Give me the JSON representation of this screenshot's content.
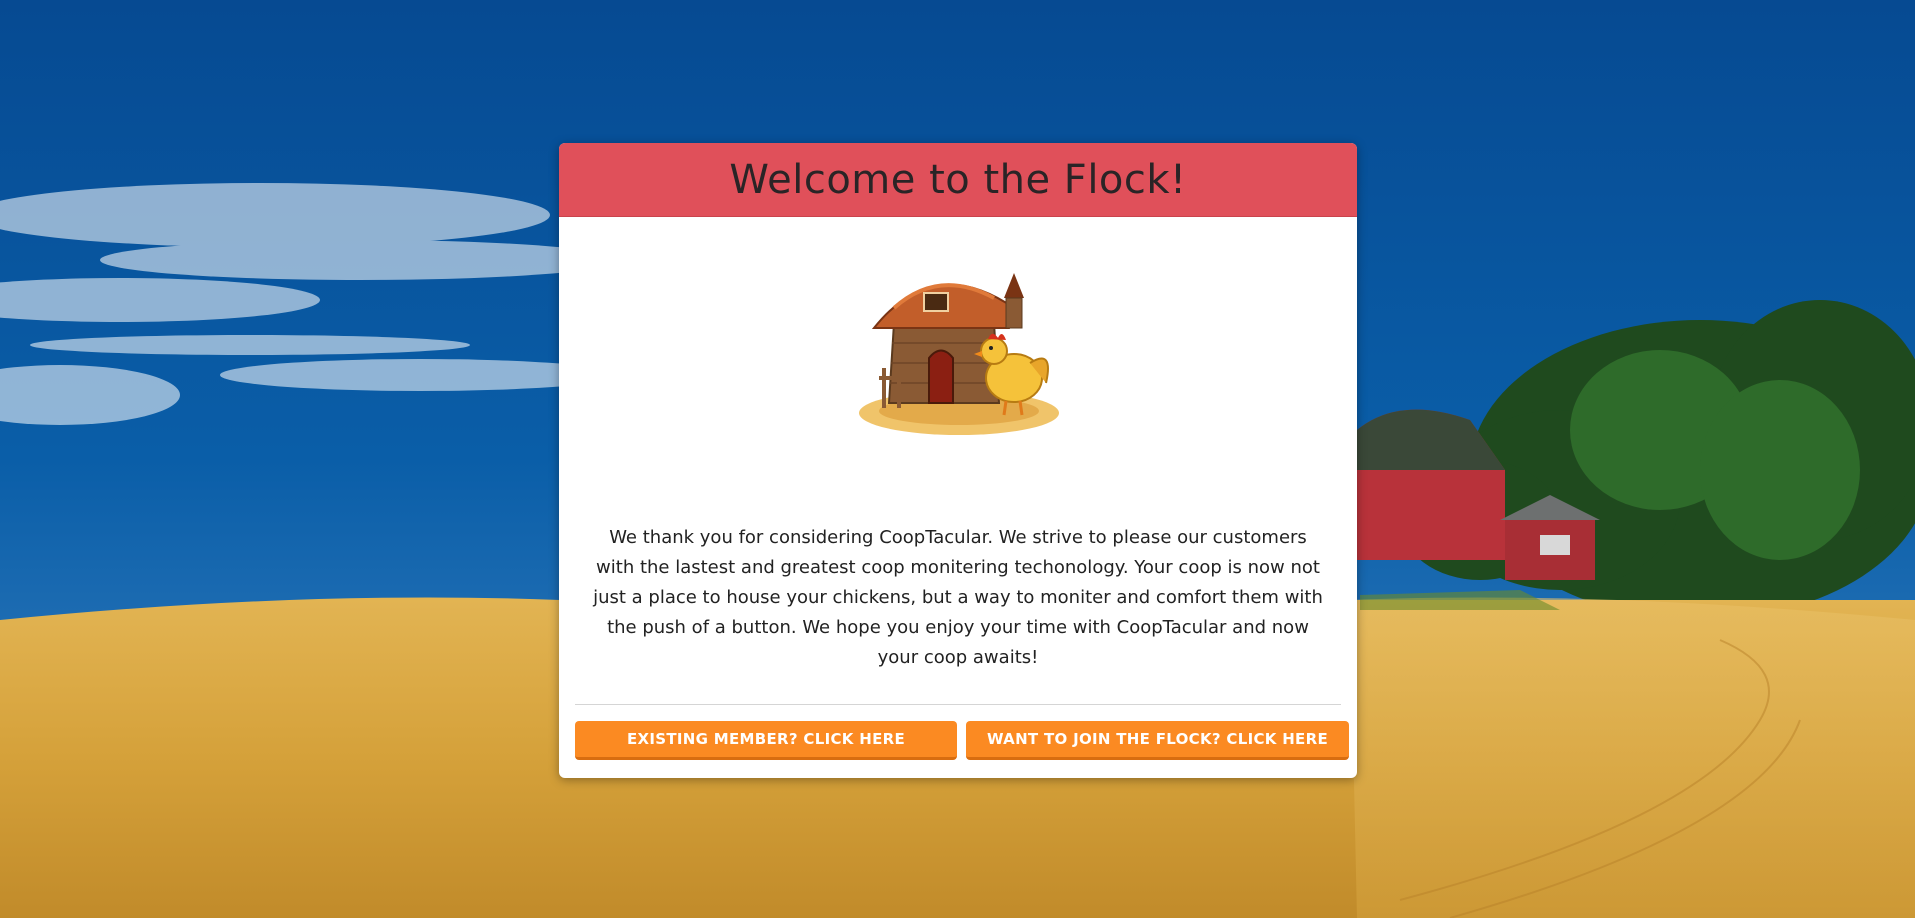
{
  "modal": {
    "title": "Welcome to the Flock!",
    "message": "We thank you for considering CoopTacular. We strive to please our customers with the lastest and greatest coop monitering techonology. Your coop is now not just a place to house your chickens, but a way to moniter and comfort them with the push of a button. We hope you enjoy your time with CoopTacular and now your coop awaits!",
    "buttons": {
      "existing_member": "EXISTING MEMBER? CLICK HERE",
      "join": "WANT TO JOIN THE FLOCK? CLICK HERE"
    }
  },
  "colors": {
    "header_bg": "#e0505a",
    "button_bg": "#fb8a22",
    "card_bg": "#ffffff",
    "sky": "#0a5ea8",
    "wheat": "#d9a73c"
  },
  "illustration": "chicken-coop-with-hen"
}
